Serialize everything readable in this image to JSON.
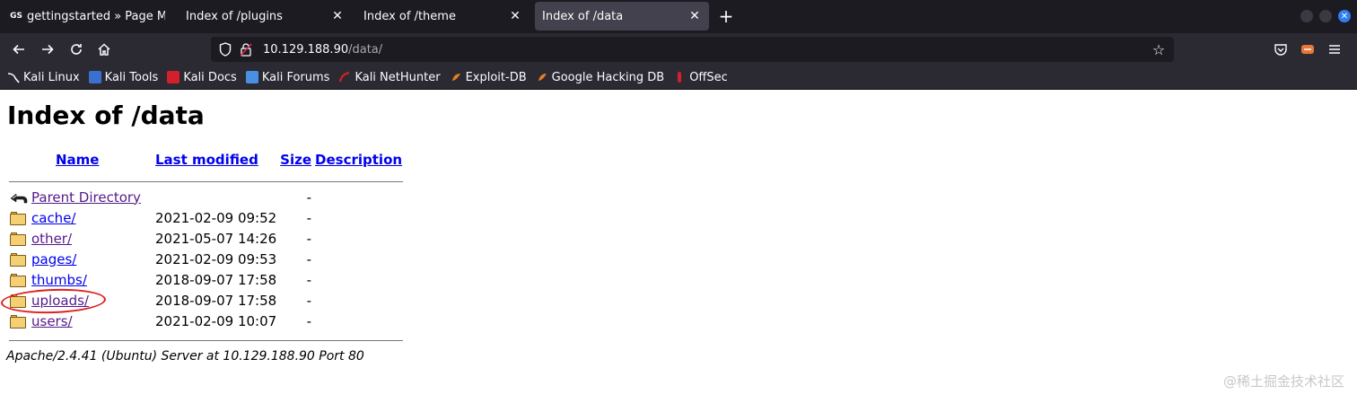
{
  "tabs": [
    {
      "favicon": "GS",
      "title": "gettingstarted » Page Ma",
      "selected": false
    },
    {
      "favicon": "",
      "title": "Index of /plugins",
      "selected": false
    },
    {
      "favicon": "",
      "title": "Index of /theme",
      "selected": false
    },
    {
      "favicon": "",
      "title": "Index of /data",
      "selected": true
    }
  ],
  "nav": {
    "url_host": "10.129.188.90",
    "url_path": "/data/"
  },
  "bookmarks": [
    {
      "label": "Kali Linux",
      "icon_color": "#367bf0"
    },
    {
      "label": "Kali Tools",
      "icon_color": "#e04e39"
    },
    {
      "label": "Kali Docs",
      "icon_color": "#d3202a"
    },
    {
      "label": "Kali Forums",
      "icon_color": "#4a90e2"
    },
    {
      "label": "Kali NetHunter",
      "icon_color": "#e02020"
    },
    {
      "label": "Exploit-DB",
      "icon_color": "#e67e22"
    },
    {
      "label": "Google Hacking DB",
      "icon_color": "#e67e22"
    },
    {
      "label": "OffSec",
      "icon_color": "#d3202a"
    }
  ],
  "page": {
    "title": "Index of /data",
    "columns": {
      "name": "Name",
      "last_modified": "Last modified",
      "size": "Size",
      "description": "Description"
    },
    "parent": {
      "name": "Parent Directory",
      "size": "-"
    },
    "entries": [
      {
        "name": "cache/",
        "modified": "2021-02-09 09:52",
        "size": "-"
      },
      {
        "name": "other/",
        "modified": "2021-05-07 14:26",
        "size": "-"
      },
      {
        "name": "pages/",
        "modified": "2021-02-09 09:53",
        "size": "-"
      },
      {
        "name": "thumbs/",
        "modified": "2018-09-07 17:58",
        "size": "-"
      },
      {
        "name": "uploads/",
        "modified": "2018-09-07 17:58",
        "size": "-"
      },
      {
        "name": "users/",
        "modified": "2021-02-09 10:07",
        "size": "-"
      }
    ],
    "server_signature": "Apache/2.4.41 (Ubuntu) Server at 10.129.188.90 Port 80"
  },
  "watermark": "@稀土掘金技术社区",
  "colors": {
    "visited_link": "#551a8b",
    "link": "#0000ee",
    "annotation": "#e02020"
  }
}
